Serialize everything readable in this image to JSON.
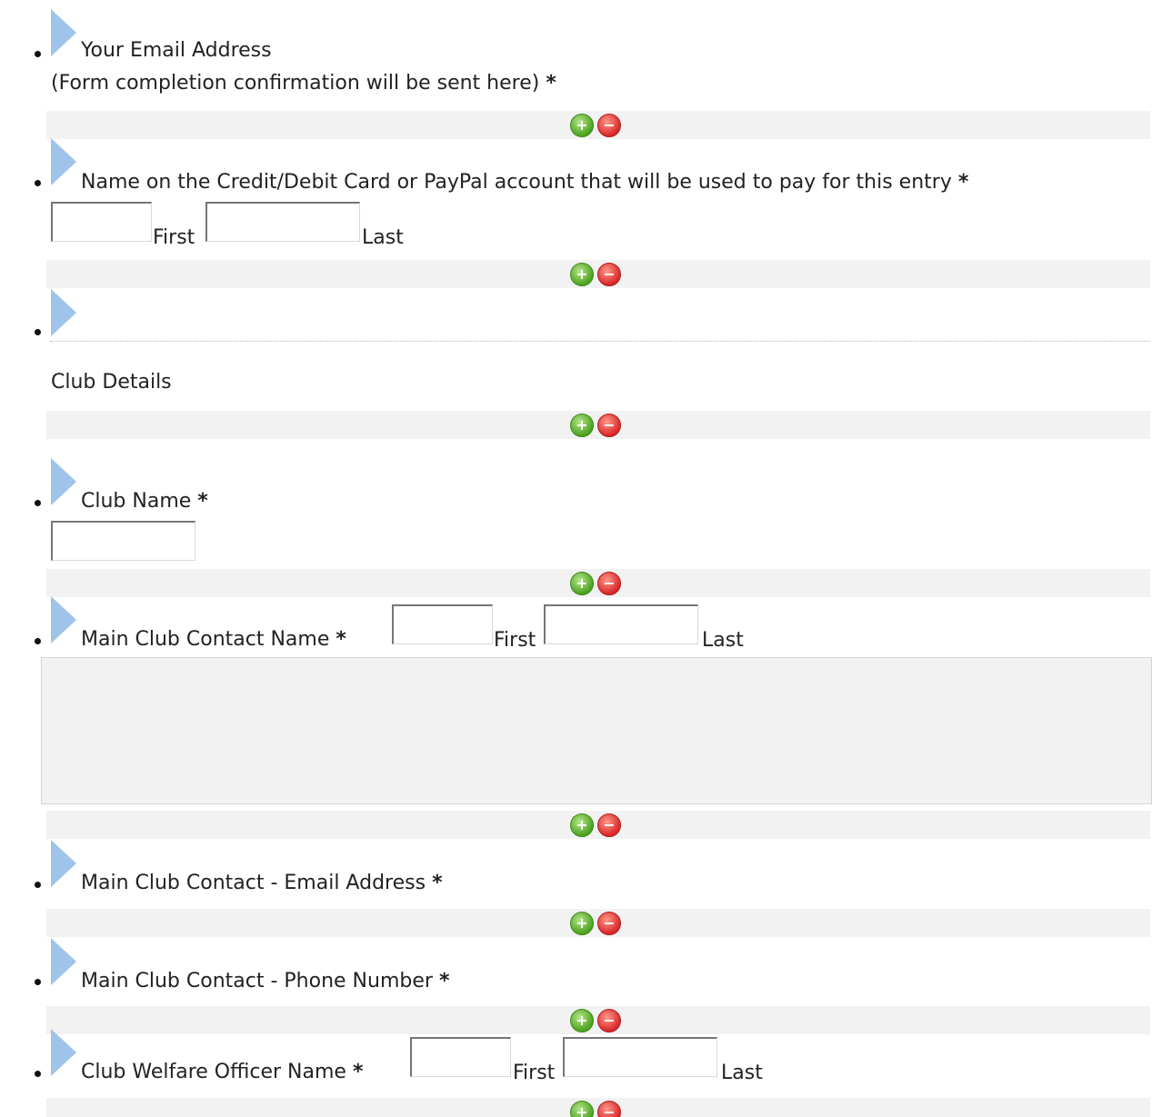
{
  "required_mark": "*",
  "buttons": {
    "add_glyph": "+",
    "remove_glyph": "−"
  },
  "fields": [
    {
      "label": "Your Email Address",
      "subtext": "(Form completion confirmation will be sent here)"
    },
    {
      "label": "Name on the Credit/Debit Card or PayPal account that will be used to pay for this entry",
      "first": "First",
      "last": "Last"
    },
    {
      "label": "",
      "section_title": "Club Details"
    },
    {
      "label": "Club Name"
    },
    {
      "label": "Main Club Contact Name",
      "first": "First",
      "last": "Last"
    },
    {
      "label": "Main Club Contact - Email Address"
    },
    {
      "label": "Main Club Contact - Phone Number"
    },
    {
      "label": "Club Welfare Officer Name",
      "first": "First",
      "last": "Last"
    }
  ]
}
